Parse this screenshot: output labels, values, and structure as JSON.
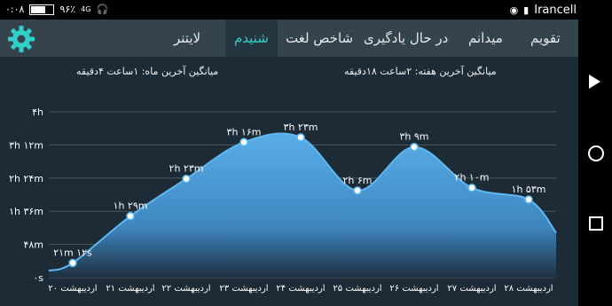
{
  "status_bar": {
    "time": "۰:۰۸",
    "battery": "۹۶٪",
    "network": "4G",
    "carrier": "Irancell"
  },
  "tabs": [
    {
      "label": "تقویم"
    },
    {
      "label": "میدانم"
    },
    {
      "label": "در حال یادگیری"
    },
    {
      "label": "شاخص لغت"
    },
    {
      "label": "شنیدم"
    },
    {
      "label": "لایتنر"
    }
  ],
  "averages": {
    "week": "میانگین آخرین هفته: ۲ساعت  ۱۸دقیقه",
    "month": "میانگین آخرین ماه: ۱ساعت  ۴دقیقه"
  },
  "chart_data": {
    "type": "area",
    "y_tick_labels": [
      "۰s",
      "۴۸m",
      "۱h ۳۶m",
      "۲h ۲۴m",
      "۳h ۱۲m",
      "۴h"
    ],
    "x_tick_labels": [
      "۲۰ اردیبهشت",
      "۲۱ اردیبهشت",
      "۲۲ اردیبهشت",
      "۲۳ اردیبهشت",
      "۲۴ اردیبهشت",
      "۲۵ اردیبهشت",
      "۲۶ اردیبهشت",
      "۲۷ اردیبهشت",
      "۲۸ اردیبهشت"
    ],
    "categories": [
      "۲۰ اردیبهشت",
      "۲۱ اردیبهشت",
      "۲۲ اردیبهشت",
      "۲۳ اردیبهشت",
      "۲۴ اردیبهشت",
      "۲۵ اردیبهشت",
      "۲۶ اردیبهشت",
      "۲۷ اردیبهشت",
      "۲۸ اردیبهشت"
    ],
    "values_minutes": [
      21.2,
      89,
      143,
      196,
      203,
      126,
      189,
      130,
      113
    ],
    "value_labels": [
      "۲۱m ۱۲s",
      "۱h ۲۹m",
      "۲h ۲۳m",
      "۳h ۱۶m",
      "۳h ۲۳m",
      "۲h ۶m",
      "۳h ۹m",
      "۲h ۱۰m",
      "۱h ۵۳m"
    ],
    "ylim": [
      0,
      240
    ],
    "colors": {
      "line": "#5fb8f0",
      "fill_top": "#5aaee8",
      "fill_bottom": "#1e3040",
      "grid": "#4a5862"
    }
  }
}
